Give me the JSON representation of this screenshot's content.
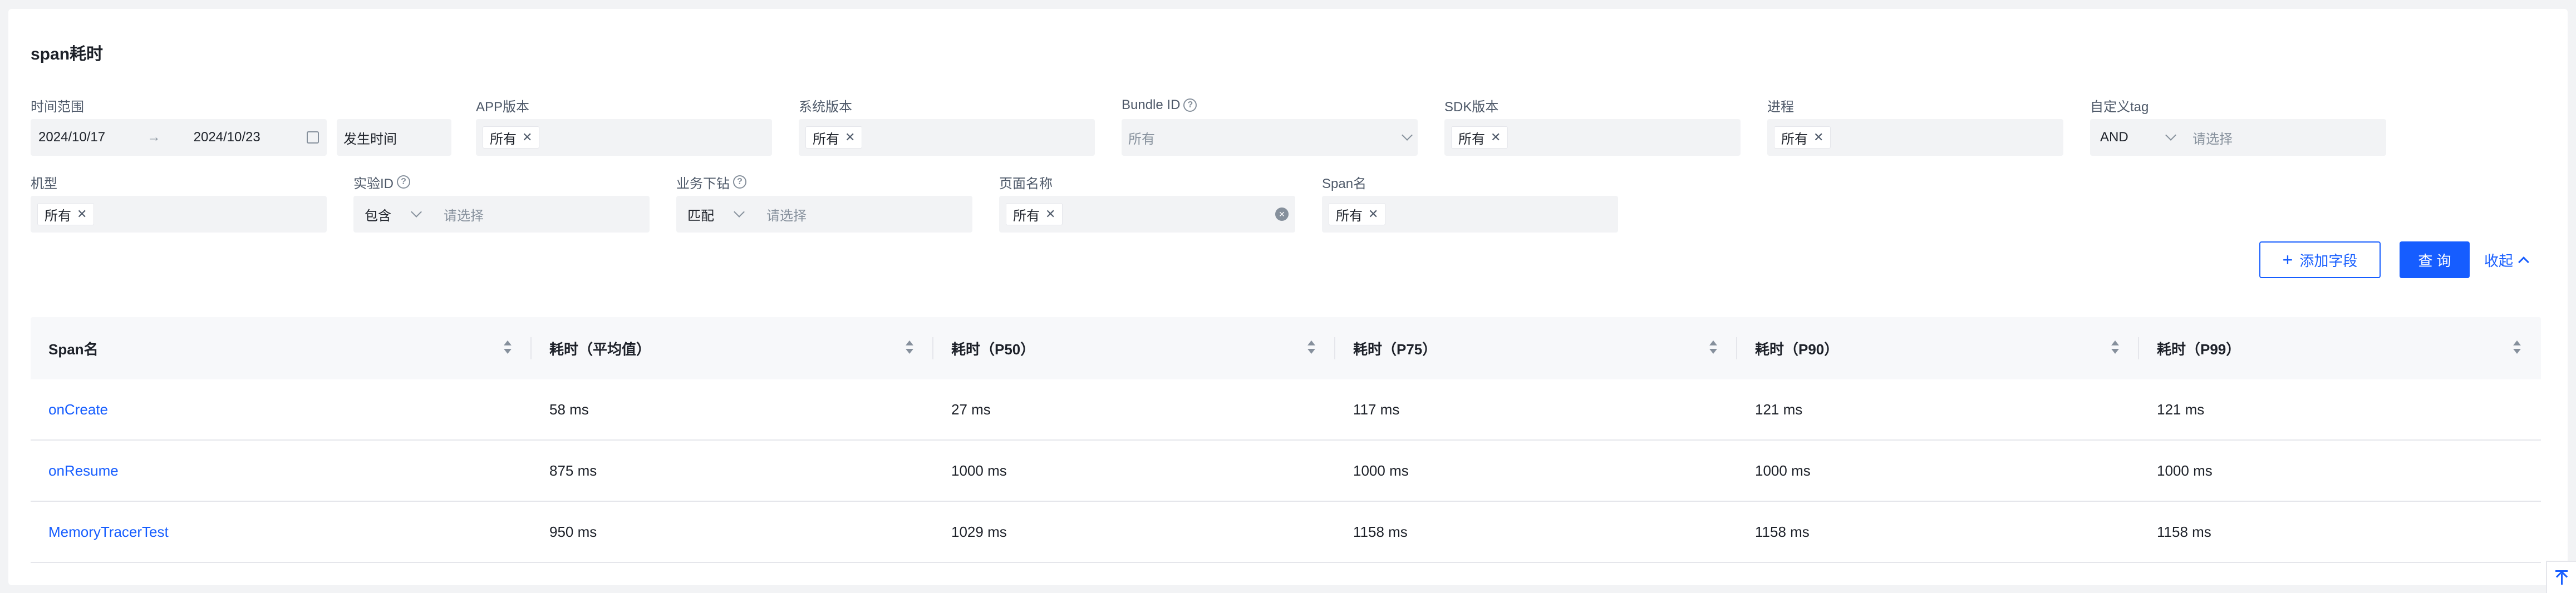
{
  "page": {
    "title": "span耗时"
  },
  "filters": {
    "time_range": {
      "label": "时间范围",
      "start": "2024/10/17",
      "arrow": "→",
      "end": "2024/10/23",
      "type_label": "发生时间"
    },
    "app_version": {
      "label": "APP版本",
      "tag": "所有"
    },
    "os_version": {
      "label": "系统版本",
      "tag": "所有"
    },
    "bundle_id": {
      "label": "Bundle ID",
      "value": "所有"
    },
    "sdk_version": {
      "label": "SDK版本",
      "tag": "所有"
    },
    "process": {
      "label": "进程",
      "tag": "所有"
    },
    "custom_tag": {
      "label": "自定义tag",
      "op": "AND",
      "placeholder": "请选择"
    },
    "device_model": {
      "label": "机型",
      "tag": "所有"
    },
    "experiment_id": {
      "label": "实验ID",
      "op": "包含",
      "placeholder": "请选择"
    },
    "biz_drilldown": {
      "label": "业务下钻",
      "op": "匹配",
      "placeholder": "请选择"
    },
    "page_name": {
      "label": "页面名称",
      "tag": "所有"
    },
    "span_name": {
      "label": "Span名",
      "tag": "所有"
    }
  },
  "actions": {
    "add_field": "添加字段",
    "query": "查 询",
    "collapse": "收起"
  },
  "table": {
    "columns": [
      "Span名",
      "耗时（平均值）",
      "耗时（P50）",
      "耗时（P75）",
      "耗时（P90）",
      "耗时（P99）"
    ],
    "rows": [
      [
        "onCreate",
        "58 ms",
        "27 ms",
        "117 ms",
        "121 ms",
        "121 ms"
      ],
      [
        "onResume",
        "875 ms",
        "1000 ms",
        "1000 ms",
        "1000 ms",
        "1000 ms"
      ],
      [
        "MemoryTracerTest",
        "950 ms",
        "1029 ms",
        "1158 ms",
        "1158 ms",
        "1158 ms"
      ]
    ]
  },
  "colors": {
    "primary": "#165dff",
    "input_bg": "#f2f3f5",
    "page_bg": "#f2f3f5"
  }
}
